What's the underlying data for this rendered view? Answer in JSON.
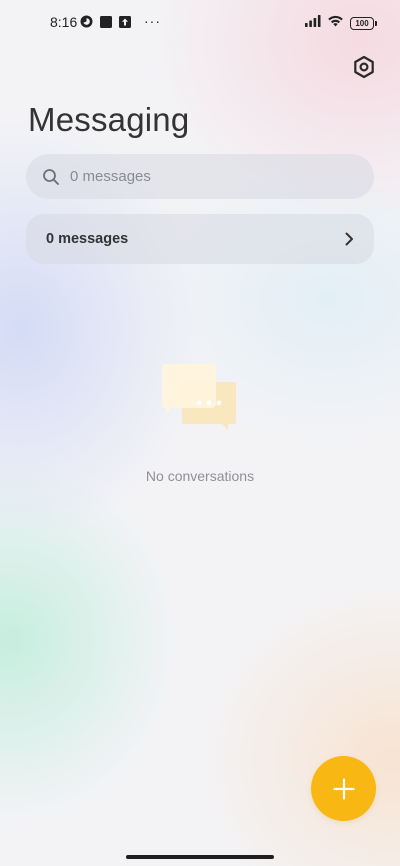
{
  "status_bar": {
    "time": "8:16",
    "battery": "100",
    "left_icons": [
      "app-notification-icon",
      "square-notification-icon",
      "upload-notification-icon"
    ],
    "more": "···",
    "right_icons": [
      "cellular-signal-icon",
      "wifi-icon",
      "battery-icon"
    ]
  },
  "header": {
    "title": "Messaging",
    "settings_icon": "settings-icon"
  },
  "search": {
    "placeholder": "0 messages",
    "value": ""
  },
  "summary": {
    "label": "0 messages",
    "icon": "chevron-right-icon"
  },
  "empty_state": {
    "icon": "chat-bubbles-icon",
    "text": "No conversations"
  },
  "fab": {
    "icon": "plus-icon",
    "color": "#f9b713"
  },
  "colors": {
    "accent": "#f9b713",
    "text_primary": "#333333",
    "text_secondary": "#8f9096"
  }
}
